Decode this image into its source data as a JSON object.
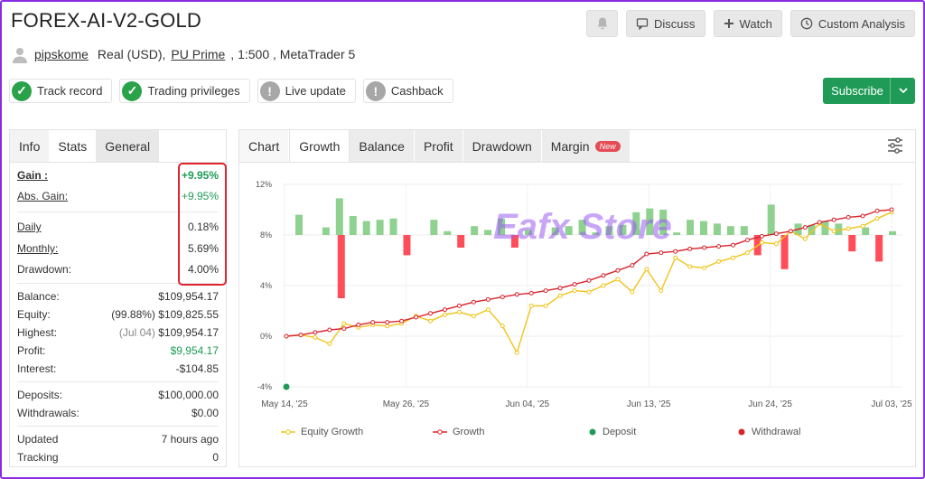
{
  "header": {
    "title": "FOREX-AI-V2-GOLD",
    "buttons": {
      "discuss": "Discuss",
      "watch": "Watch",
      "custom": "Custom Analysis"
    }
  },
  "owner": {
    "username": "pipskome",
    "account_type": "Real (USD),",
    "broker": "PU Prime",
    "details": ", 1:500 , MetaTrader 5"
  },
  "badges": [
    {
      "label": "Track record",
      "status": "ok"
    },
    {
      "label": "Trading privileges",
      "status": "ok"
    },
    {
      "label": "Live update",
      "status": "warn"
    },
    {
      "label": "Cashback",
      "status": "warn"
    }
  ],
  "subscribe": {
    "label": "Subscribe"
  },
  "left_tabs": [
    "Info",
    "Stats",
    "General"
  ],
  "stats": {
    "gain": {
      "label": "Gain :",
      "value": "+9.95%"
    },
    "abs_gain": {
      "label": "Abs. Gain:",
      "value": "+9.95%"
    },
    "daily": {
      "label": "Daily",
      "value": "0.18%"
    },
    "monthly": {
      "label": "Monthly:",
      "value": "5.69%"
    },
    "drawdown": {
      "label": "Drawdown:",
      "value": "4.00%"
    },
    "balance": {
      "label": "Balance:",
      "value": "$109,954.17"
    },
    "equity": {
      "label": "Equity:",
      "prefix": "(99.88%)",
      "value": "$109,825.55"
    },
    "highest": {
      "label": "Highest:",
      "prefix": "(Jul 04)",
      "value": "$109,954.17"
    },
    "profit": {
      "label": "Profit:",
      "value": "$9,954.17"
    },
    "interest": {
      "label": "Interest:",
      "value": "-$104.85"
    },
    "deposits": {
      "label": "Deposits:",
      "value": "$100,000.00"
    },
    "withdrawals": {
      "label": "Withdrawals:",
      "value": "$0.00"
    },
    "updated": {
      "label": "Updated",
      "value": "7 hours ago"
    },
    "tracking": {
      "label": "Tracking",
      "value": "0"
    }
  },
  "right_tabs": {
    "chart": "Chart",
    "growth": "Growth",
    "balance": "Balance",
    "profit": "Profit",
    "drawdown": "Drawdown",
    "margin": "Margin",
    "new_badge": "New"
  },
  "watermark": "Eafx Store",
  "colors": {
    "green": "#1f9b57",
    "equity": "#f0c419",
    "growth": "#d9232d",
    "bar_pos": "#8fd18f",
    "bar_neg": "#ff4d5a"
  },
  "chart_data": {
    "type": "line",
    "ylim": [
      -4,
      12
    ],
    "yticks": [
      "12%",
      "8%",
      "4%",
      "0%",
      "-4%"
    ],
    "xticks": [
      "May 14, '25",
      "May 26, '25",
      "Jun 04, '25",
      "Jun 13, '25",
      "Jun 24, '25",
      "Jul 03, '25"
    ],
    "legend": [
      "Equity Growth",
      "Growth",
      "Deposit",
      "Withdrawal"
    ],
    "series": [
      {
        "name": "Growth",
        "values": [
          0,
          0.1,
          0.3,
          0.5,
          0.6,
          0.9,
          1.1,
          1.1,
          1.2,
          1.5,
          1.8,
          2.1,
          2.4,
          2.7,
          2.9,
          3.1,
          3.3,
          3.4,
          3.6,
          3.8,
          4.1,
          4.4,
          4.8,
          5.2,
          5.6,
          6.5,
          6.6,
          6.7,
          6.9,
          7.0,
          7.1,
          7.2,
          7.6,
          7.9,
          8.1,
          8.3,
          8.6,
          9.0,
          9.2,
          9.4,
          9.5,
          9.9,
          10.0
        ]
      },
      {
        "name": "Equity Growth",
        "values": [
          0,
          0.1,
          -0.1,
          -0.6,
          1.0,
          0.7,
          0.9,
          0.8,
          1.0,
          1.6,
          1.2,
          1.7,
          1.9,
          1.6,
          2.1,
          0.8,
          -1.3,
          2.4,
          2.4,
          3.2,
          3.6,
          3.5,
          4.0,
          4.5,
          3.5,
          5.3,
          3.6,
          6.2,
          5.5,
          5.4,
          5.9,
          6.2,
          6.6,
          7.4,
          7.3,
          8.3,
          7.7,
          8.9,
          8.3,
          8.5,
          8.7,
          9.3,
          9.8
        ]
      }
    ],
    "daily_bars": [
      1.6,
      0,
      0.6,
      2.9,
      1.5,
      1.1,
      1.2,
      1.3,
      -1.6,
      0,
      1.2,
      0.3,
      -1.0,
      0.7,
      0.4,
      1.3,
      -1.0,
      0.4,
      0,
      0.6,
      0.7,
      1.2,
      0.2,
      0.7,
      0.8,
      1.8,
      2.1,
      2.0,
      0.2,
      1.2,
      1.1,
      0.9,
      0.7,
      0.7,
      -1.6,
      2.4,
      -2.7,
      0.9,
      0.8,
      1.1,
      0.9,
      -1.3,
      0.6,
      -2.1,
      0.3
    ],
    "bar_big_neg": {
      "index": 3,
      "value": -5.0
    },
    "deposit_marker": {
      "x": 0,
      "y": -4
    }
  }
}
